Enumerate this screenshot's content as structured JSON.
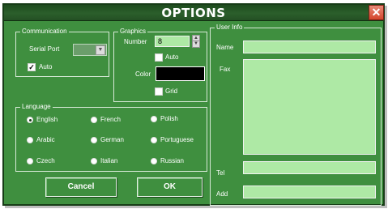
{
  "window": {
    "title": "OPTIONS",
    "close_symbol": "✕"
  },
  "communication": {
    "legend": "Communication",
    "serial_port_label": "Serial Port",
    "serial_port_value": "",
    "auto_label": "Auto",
    "auto_checked": true
  },
  "graphics": {
    "legend": "Graphics",
    "number_label": "Number",
    "number_value": "8",
    "auto_label": "Auto",
    "auto_checked": false,
    "color_label": "Color",
    "color_value": "#000000",
    "grid_label": "Grid",
    "grid_checked": false
  },
  "language": {
    "legend": "Language",
    "selected": "English",
    "options": [
      "English",
      "French",
      "Polish",
      "Arabic",
      "German",
      "Portuguese",
      "Czech",
      "Italian",
      "Russian"
    ]
  },
  "user_info": {
    "legend": "User Info",
    "name_label": "Name",
    "fax_label": "Fax",
    "tel_label": "Tel",
    "add_label": "Add",
    "name_value": "",
    "fax_value": "",
    "tel_value": "",
    "add_value": ""
  },
  "buttons": {
    "cancel": "Cancel",
    "ok": "OK"
  },
  "colors": {
    "dialog_background": "#3f8f3f",
    "field_background": "#aee9a5",
    "close_button": "#d4452c"
  }
}
